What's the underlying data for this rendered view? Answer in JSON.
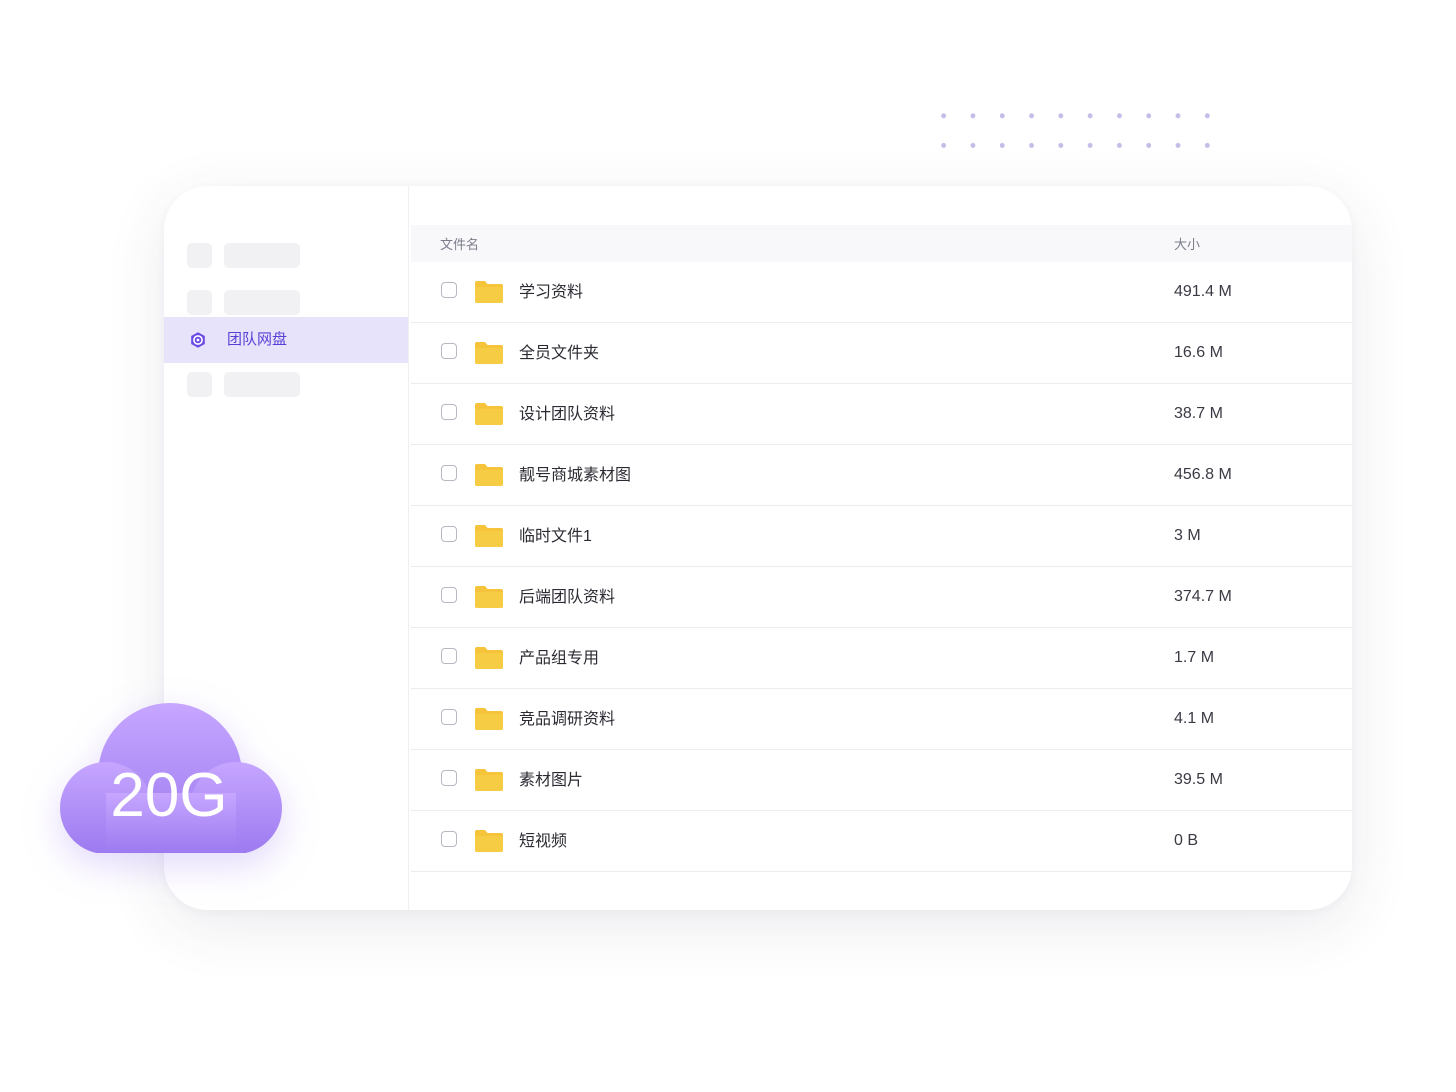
{
  "sidebar": {
    "active_item": {
      "label": "团队网盘",
      "icon": "team-drive-icon"
    },
    "accent_color": "#6a4ae3",
    "active_bg": "#e7e3fb"
  },
  "table": {
    "headers": {
      "name": "文件名",
      "size": "大小"
    },
    "rows": [
      {
        "name": "学习资料",
        "size": "491.4 M"
      },
      {
        "name": "全员文件夹",
        "size": "16.6 M"
      },
      {
        "name": "设计团队资料",
        "size": "38.7 M"
      },
      {
        "name": "靓号商城素材图",
        "size": "456.8 M"
      },
      {
        "name": "临时文件1",
        "size": "3 M"
      },
      {
        "name": "后端团队资料",
        "size": "374.7 M"
      },
      {
        "name": "产品组专用",
        "size": "1.7 M"
      },
      {
        "name": "竞品调研资料",
        "size": "4.1 M"
      },
      {
        "name": "素材图片",
        "size": "39.5 M"
      },
      {
        "name": "短视频",
        "size": "0 B"
      }
    ],
    "folder_color": "#f5c43a"
  },
  "badge": {
    "text": "20G",
    "icon": "cloud-icon",
    "gradient": [
      "#c6a6ff",
      "#9c7af0"
    ]
  }
}
